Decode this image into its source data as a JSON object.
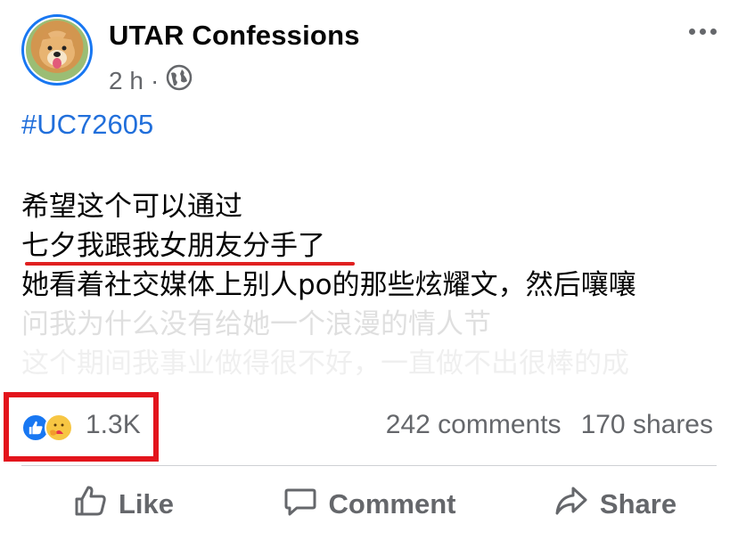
{
  "post": {
    "page_name": "UTAR Confessions",
    "time": "2 h",
    "separator": "·",
    "privacy_icon": "globe-icon",
    "hashtag": "#UC72605",
    "lines": [
      "希望这个可以通过",
      "七夕我跟我女朋友分手了",
      "她看着社交媒体上别人po的那些炫耀文，然后嚷嚷",
      "问我为什么没有给她一个浪漫的情人节",
      "这个期间我事业做得很不好，一直做不出很棒的成"
    ]
  },
  "engagement": {
    "reaction_count": "1.3K",
    "comments": "242 comments",
    "shares": "170 shares",
    "reaction_icons": [
      "like-icon",
      "care-icon"
    ],
    "highlight_color": "#e3141c"
  },
  "actions": {
    "like": "Like",
    "comment": "Comment",
    "share": "Share"
  },
  "colors": {
    "accent": "#1877f2",
    "hashtag": "#216fdb",
    "muted": "#65676b"
  }
}
